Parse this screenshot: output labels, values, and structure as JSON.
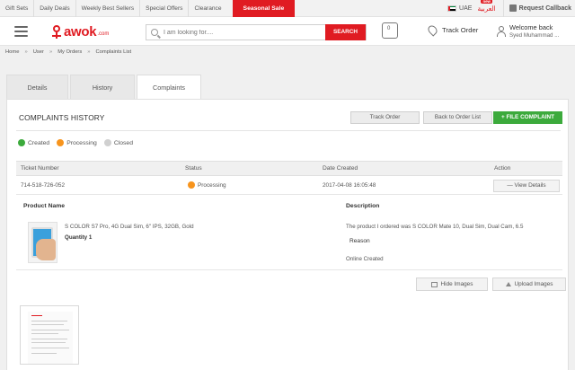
{
  "topbar": {
    "links": [
      "Gift Sets",
      "Daily Deals",
      "Weekly Best Sellers",
      "Special Offers",
      "Clearance"
    ],
    "seasonal": "Seasonal Sale",
    "country": "UAE",
    "language": "العربية",
    "new_badge": "new",
    "callback": "Request Callback"
  },
  "header": {
    "logo_word": "awok",
    "logo_suffix": ".com",
    "search_placeholder": "I am looking for....",
    "search_button": "SEARCH",
    "cart_count": "0",
    "track_order": "Track Order",
    "welcome": "Welcome back",
    "username": "Syed Muhammad ..."
  },
  "breadcrumb": [
    "Home",
    "User",
    "My Orders",
    "Complaints List"
  ],
  "tabs": [
    "Details",
    "History",
    "Complaints"
  ],
  "complaints": {
    "title": "COMPLAINTS HISTORY",
    "track_order_btn": "Track Order",
    "back_btn": "Back to Order List",
    "file_btn": "+  FILE COMPLAINT",
    "legend": [
      "Created",
      "Processing",
      "Closed"
    ],
    "columns": [
      "Ticket Number",
      "Status",
      "Date Created",
      "Action"
    ],
    "row": {
      "ticket": "714-518-726-052",
      "status": "Processing",
      "date": "2017-04-08 16:05:48",
      "action": "—  View Details"
    },
    "detail": {
      "product_label": "Product Name",
      "description_label": "Description",
      "product_name": "S COLOR S7 Pro, 4G Dual Sim, 6\" IPS, 32GB, Gold",
      "quantity": "Quantity 1",
      "description": "The product I ordered was S COLOR Mate 10, Dual Sim, Dual Cam, 6.5",
      "reason": "Reason",
      "online": "Online Created",
      "hide_images": "Hide Images",
      "upload_images": "Upload Images"
    }
  },
  "colors": {
    "brand_red": "#e01b22",
    "green": "#3caa3c",
    "processing": "#f7941d",
    "closed": "#d0d0d0"
  }
}
